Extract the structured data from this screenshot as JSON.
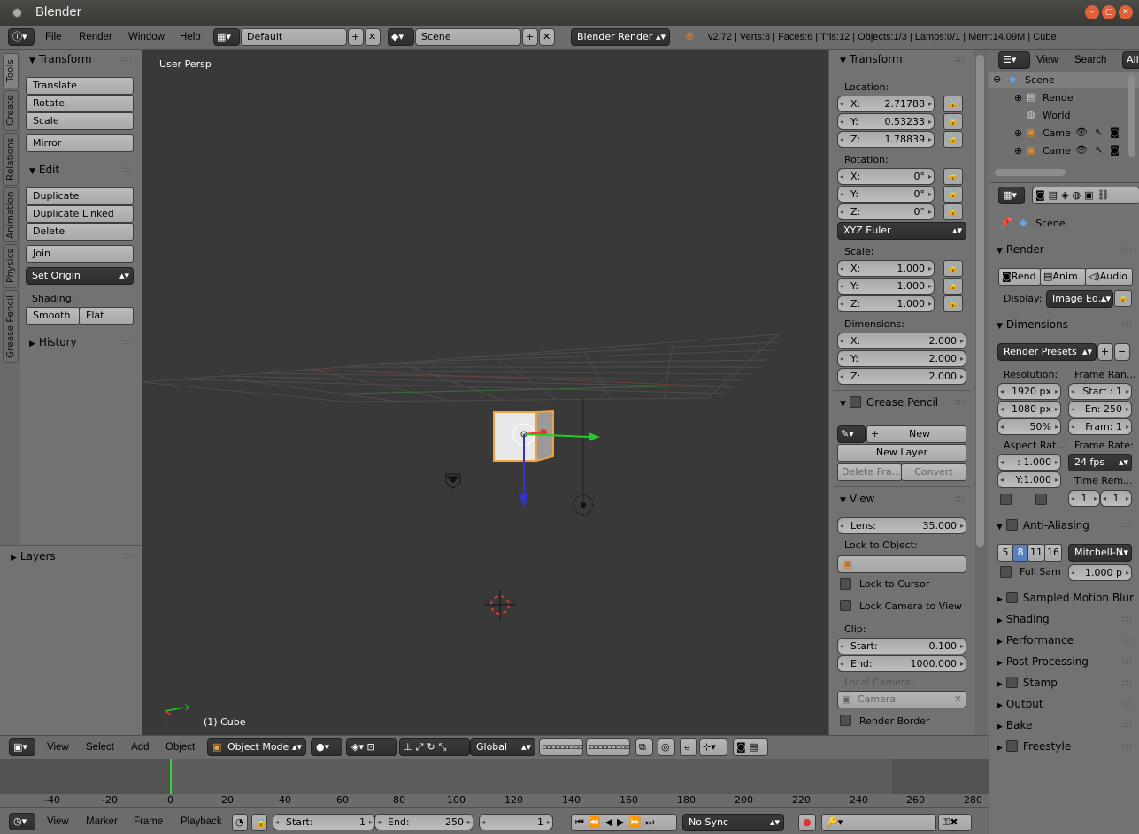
{
  "window": {
    "title": "Blender",
    "controls": [
      "–",
      "▢",
      "✕"
    ]
  },
  "topbar": {
    "menus": [
      "File",
      "Render",
      "Window",
      "Help"
    ],
    "layout": "Default",
    "scene": "Scene",
    "engine": "Blender Render",
    "stats": "v2.72 | Verts:8 | Faces:6 | Tris:12 | Objects:1/3 | Lamps:0/1 | Mem:14.09M | Cube"
  },
  "tool_tabs": [
    "Tools",
    "Create",
    "Relations",
    "Animation",
    "Physics",
    "Grease Pencil"
  ],
  "toolshelf": {
    "transform_title": "Transform",
    "transform_buttons": [
      "Translate",
      "Rotate",
      "Scale"
    ],
    "mirror": "Mirror",
    "edit_title": "Edit",
    "edit_buttons": [
      "Duplicate",
      "Duplicate Linked",
      "Delete"
    ],
    "join": "Join",
    "set_origin": "Set Origin",
    "shading_label": "Shading:",
    "smooth": "Smooth",
    "flat": "Flat",
    "history": "History",
    "layers": "Layers"
  },
  "viewport": {
    "label": "User Persp",
    "object_label": "(1) Cube"
  },
  "properties": {
    "transform_title": "Transform",
    "location_label": "Location:",
    "location": [
      {
        "axis": "X:",
        "value": "2.71788"
      },
      {
        "axis": "Y:",
        "value": "0.53233"
      },
      {
        "axis": "Z:",
        "value": "1.78839"
      }
    ],
    "rotation_label": "Rotation:",
    "rotation": [
      {
        "axis": "X:",
        "value": "0°"
      },
      {
        "axis": "Y:",
        "value": "0°"
      },
      {
        "axis": "Z:",
        "value": "0°"
      }
    ],
    "rotation_mode": "XYZ Euler",
    "scale_label": "Scale:",
    "scale": [
      {
        "axis": "X:",
        "value": "1.000"
      },
      {
        "axis": "Y:",
        "value": "1.000"
      },
      {
        "axis": "Z:",
        "value": "1.000"
      }
    ],
    "dimensions_label": "Dimensions:",
    "dimensions": [
      {
        "axis": "X:",
        "value": "2.000"
      },
      {
        "axis": "Y:",
        "value": "2.000"
      },
      {
        "axis": "Z:",
        "value": "2.000"
      }
    ],
    "grease_pencil_title": "Grease Pencil",
    "gp_new": "New",
    "gp_new_layer": "New Layer",
    "gp_delete_frame": "Delete Fra...",
    "gp_convert": "Convert",
    "view_title": "View",
    "lens_label": "Lens:",
    "lens_value": "35.000",
    "lock_object_label": "Lock to Object:",
    "lock_cursor": "Lock to Cursor",
    "lock_camera": "Lock Camera to View",
    "clip_label": "Clip:",
    "clip_start_label": "Start:",
    "clip_start": "0.100",
    "clip_end_label": "End:",
    "clip_end": "1000.000",
    "local_camera_label": "Local Camera:",
    "local_camera": "Camera",
    "render_border": "Render Border"
  },
  "viewport_header": {
    "menus": [
      "View",
      "Select",
      "Add",
      "Object"
    ],
    "mode": "Object Mode",
    "orientation": "Global"
  },
  "timeline": {
    "ticks": [
      "-40",
      "-20",
      "0",
      "20",
      "40",
      "60",
      "80",
      "100",
      "120",
      "140",
      "160",
      "180",
      "200",
      "220",
      "240",
      "260",
      "280"
    ],
    "current_frame": 1
  },
  "timeline_header": {
    "menus": [
      "View",
      "Marker",
      "Frame",
      "Playback"
    ],
    "start_label": "Start:",
    "start": "1",
    "end_label": "End:",
    "end": "250",
    "frame": "1",
    "sync": "No Sync"
  },
  "outliner": {
    "menus": [
      "View",
      "Search"
    ],
    "filter": "All",
    "items": [
      {
        "label": "Scene",
        "icon": "scene-icon"
      },
      {
        "label": "Rende",
        "icon": "render-layers-icon"
      },
      {
        "label": "World",
        "icon": "world-icon"
      },
      {
        "label": "Came",
        "icon": "camera-icon"
      },
      {
        "label": "Came",
        "icon": "camera-icon"
      }
    ]
  },
  "render_props": {
    "context": "Scene",
    "render_title": "Render",
    "render_buttons": [
      "Rend",
      "Anim",
      "Audio"
    ],
    "display_label": "Display:",
    "display_value": "Image Ed...",
    "dimensions_title": "Dimensions",
    "presets": "Render Presets",
    "resolution_label": "Resolution:",
    "res_x": "1920 px",
    "res_y": "1080 px",
    "res_pct": "50%",
    "frame_range_label": "Frame Ran...",
    "frame_start": "Start : 1",
    "frame_end": "En: 250",
    "frame_step": "Fram: 1",
    "aspect_label": "Aspect Rat...",
    "aspect_x": ": 1.000",
    "aspect_y": "Y:1.000",
    "frame_rate_label": "Frame Rate:",
    "frame_rate": "24 fps",
    "time_remap_label": "Time Rem...",
    "time_remap_old": "1",
    "time_remap_new": "1",
    "aa_title": "Anti-Aliasing",
    "aa_samples": [
      "5",
      "8",
      "11",
      "16"
    ],
    "aa_filter": "Mitchell-N",
    "full_sample": "Full Sam",
    "filter_size": "1.000 p",
    "sections": [
      "Sampled Motion Blur",
      "Shading",
      "Performance",
      "Post Processing",
      "Stamp",
      "Output",
      "Bake",
      "Freestyle"
    ]
  },
  "colors": {
    "accent_orange": "#f0a040",
    "selected_blue": "#5680c2",
    "viewport_bg": "#393939"
  }
}
